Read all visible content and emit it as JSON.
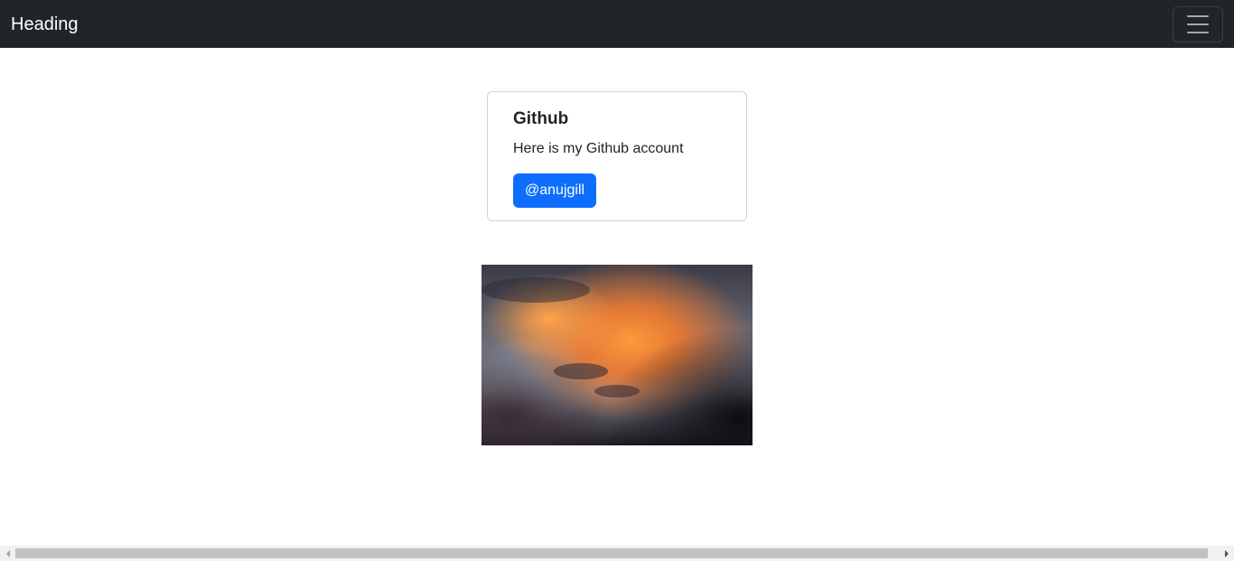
{
  "navbar": {
    "brand": "Heading",
    "toggler_icon": "hamburger-icon",
    "background": "#212529"
  },
  "card": {
    "title": "Github",
    "text": "Here is my Github account",
    "button_label": "@anujgill",
    "button_color": "#0d6efd"
  },
  "image": {
    "subject": "sunset clouds"
  },
  "scrollbar": {
    "left_icon": "arrow-left-icon",
    "right_icon": "arrow-right-icon"
  }
}
